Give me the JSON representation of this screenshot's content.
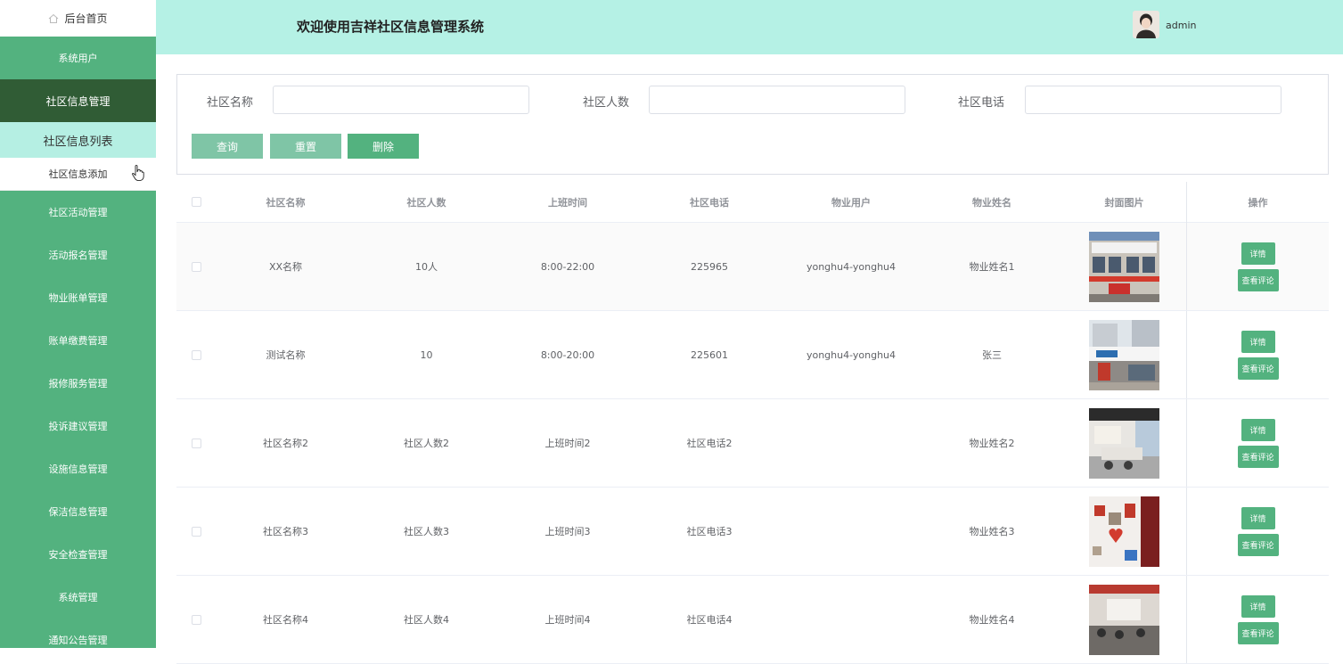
{
  "sidebar": {
    "home_label": "后台首页",
    "items": [
      {
        "label": "系统用户"
      },
      {
        "label": "社区信息管理"
      },
      {
        "label": "社区信息列表"
      },
      {
        "label": "社区信息添加"
      },
      {
        "label": "社区活动管理"
      },
      {
        "label": "活动报名管理"
      },
      {
        "label": "物业账单管理"
      },
      {
        "label": "账单缴费管理"
      },
      {
        "label": "报修服务管理"
      },
      {
        "label": "投诉建议管理"
      },
      {
        "label": "设施信息管理"
      },
      {
        "label": "保洁信息管理"
      },
      {
        "label": "安全检查管理"
      },
      {
        "label": "系统管理"
      },
      {
        "label": "通知公告管理"
      }
    ]
  },
  "header": {
    "title": "欢迎使用吉祥社区信息管理系统",
    "user": "admin"
  },
  "search": {
    "name_label": "社区名称",
    "count_label": "社区人数",
    "phone_label": "社区电话",
    "name_value": "",
    "count_value": "",
    "phone_value": "",
    "query_label": "查询",
    "reset_label": "重置",
    "delete_label": "删除"
  },
  "table": {
    "columns": [
      "社区名称",
      "社区人数",
      "上班时间",
      "社区电话",
      "物业用户",
      "物业姓名",
      "封面图片",
      "操作"
    ],
    "detail_label": "详情",
    "comment_label": "查看评论",
    "rows": [
      {
        "name": "XX名称",
        "count": "10人",
        "hours": "8:00-22:00",
        "phone": "225965",
        "user": "yonghu4-yonghu4",
        "manager": "物业姓名1"
      },
      {
        "name": "测试名称",
        "count": "10",
        "hours": "8:00-20:00",
        "phone": "225601",
        "user": "yonghu4-yonghu4",
        "manager": "张三"
      },
      {
        "name": "社区名称2",
        "count": "社区人数2",
        "hours": "上班时间2",
        "phone": "社区电话2",
        "user": "",
        "manager": "物业姓名2"
      },
      {
        "name": "社区名称3",
        "count": "社区人数3",
        "hours": "上班时间3",
        "phone": "社区电话3",
        "user": "",
        "manager": "物业姓名3"
      },
      {
        "name": "社区名称4",
        "count": "社区人数4",
        "hours": "上班时间4",
        "phone": "社区电话4",
        "user": "",
        "manager": "物业姓名4"
      }
    ]
  },
  "colors": {
    "sidebar": "#53b27f",
    "sidebar_active": "#305c35",
    "header": "#b5f1e5",
    "button": "#53b27f"
  }
}
